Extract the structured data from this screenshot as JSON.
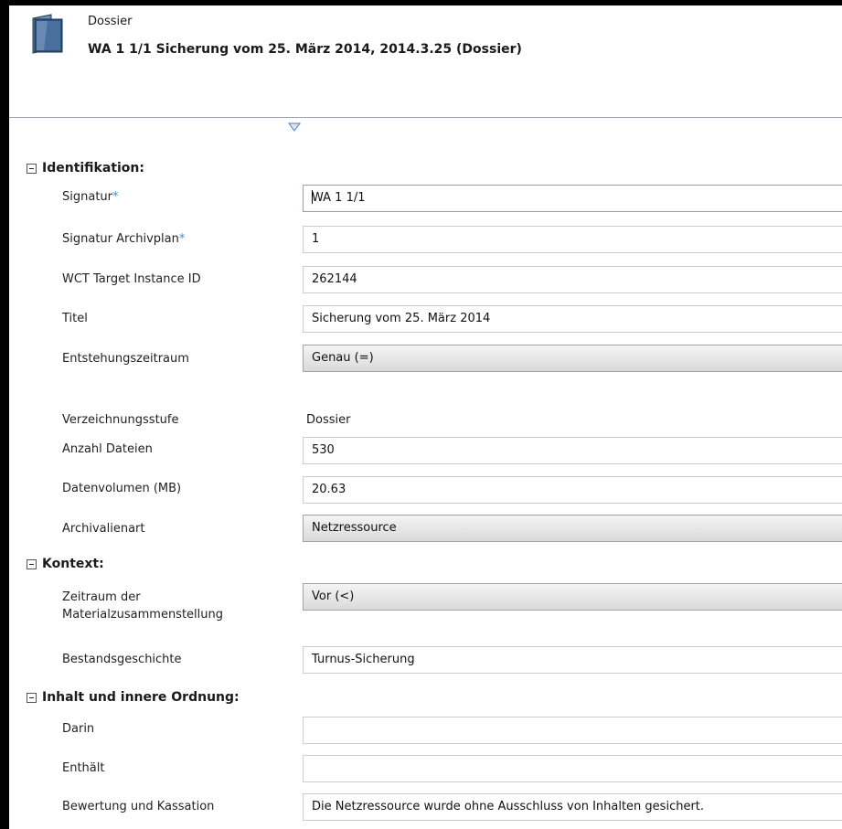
{
  "header": {
    "type_label": "Dossier",
    "title": "WA 1 1/1   Sicherung vom 25. März 2014, 2014.3.25 (Dossier)"
  },
  "sections": {
    "identifikation": "Identifikation:",
    "kontext": "Kontext:",
    "inhalt": "Inhalt und innere Ordnung:"
  },
  "required_marker": "*",
  "fields": {
    "signatur": {
      "label": "Signatur",
      "value": "WA 1 1/1"
    },
    "signatur_archivplan": {
      "label": "Signatur Archivplan",
      "value": "1"
    },
    "wct_id": {
      "label": "WCT Target Instance ID",
      "value": "262144"
    },
    "titel": {
      "label": "Titel",
      "value": "Sicherung vom 25. März 2014"
    },
    "entstehungszeitraum": {
      "label": "Entstehungszeitraum",
      "value": "Genau (=)"
    },
    "verzeichnungsstufe": {
      "label": "Verzeichnungsstufe",
      "value": "Dossier"
    },
    "anzahl_dateien": {
      "label": "Anzahl Dateien",
      "value": "530"
    },
    "datenvolumen": {
      "label": "Datenvolumen (MB)",
      "value": "20.63"
    },
    "archivalienart": {
      "label": "Archivalienart",
      "value": "Netzressource"
    },
    "zeitraum": {
      "label": "Zeitraum der Materialzusammenstellung",
      "value": "Vor (<)"
    },
    "bestandsgeschichte": {
      "label": "Bestandsgeschichte",
      "value": "Turnus-Sicherung"
    },
    "darin": {
      "label": "Darin",
      "value": ""
    },
    "enthaelt": {
      "label": "Enthält",
      "value": ""
    },
    "bewertung": {
      "label": "Bewertung und Kassation",
      "value": "Die Netzressource wurde ohne Ausschluss von Inhalten gesichert."
    }
  },
  "colors": {
    "required": "#3a8fd6",
    "folder": "#3d5f88"
  }
}
